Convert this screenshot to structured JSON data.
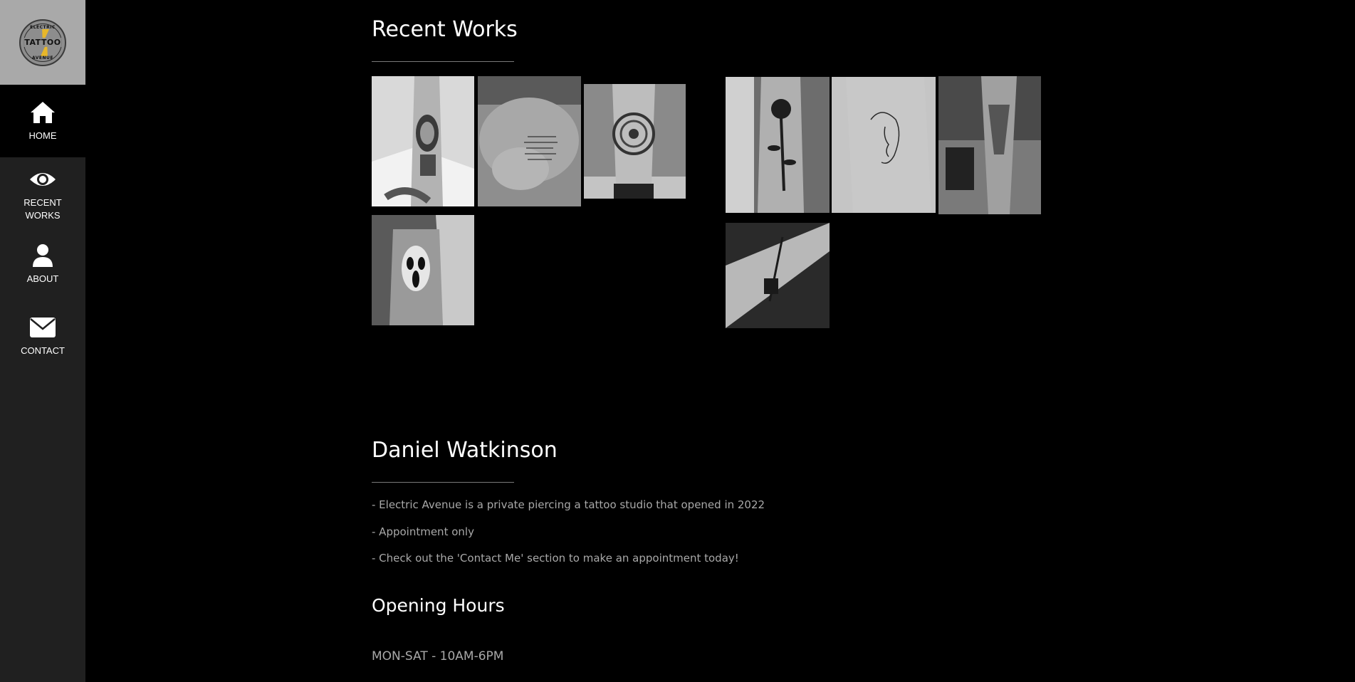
{
  "brand": {
    "logo_top": "ELECTRIC",
    "logo_main": "TATTOO",
    "logo_bottom": "AVENUE",
    "logo_bg": "#a9a9a9",
    "bolt_color": "#e7b72a"
  },
  "nav": {
    "items": [
      {
        "label": "HOME",
        "icon": "home-icon",
        "active": true
      },
      {
        "label": "RECENT WORKS",
        "icon": "eye-icon",
        "active": false
      },
      {
        "label": "ABOUT",
        "icon": "user-icon",
        "active": false
      },
      {
        "label": "CONTACT",
        "icon": "envelope-icon",
        "active": false
      }
    ]
  },
  "recent_works": {
    "title": "Recent Works",
    "images": [
      {
        "subject": "buddha-sleeve-tattoo"
      },
      {
        "subject": "chest-script-tattoo"
      },
      {
        "subject": "mandala-leg-tattoo"
      },
      {
        "subject": "rose-forearm-tattoo"
      },
      {
        "subject": "line-face-tattoo"
      },
      {
        "subject": "dotwork-leg-tattoo"
      },
      {
        "subject": "ghostface-arm-tattoo"
      },
      {
        "subject": "dagger-forearm-tattoo"
      }
    ]
  },
  "about": {
    "title": "Daniel Watkinson",
    "lines": [
      "- Electric Avenue is a private piercing a tattoo studio that opened in 2022",
      "- Appointment only",
      "- Check out the 'Contact Me' section to make an appointment today!"
    ]
  },
  "hours": {
    "title": "Opening Hours",
    "text": "MON-SAT - 10AM-6PM"
  }
}
